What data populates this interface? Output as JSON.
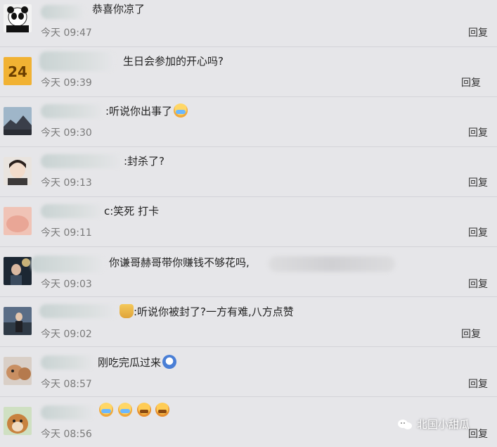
{
  "comments": [
    {
      "text": "恭喜你凉了",
      "time": "今天 09:47",
      "reply": "回复",
      "emoji": ""
    },
    {
      "text": "生日会参加的开心吗?",
      "time": "今天 09:39",
      "reply": "回复",
      "emoji": ""
    },
    {
      "text": ":听说你出事了",
      "time": "今天 09:30",
      "reply": "回复",
      "emoji": "crying-face"
    },
    {
      "text": ":封杀了?",
      "time": "今天 09:13",
      "reply": "回复",
      "emoji": ""
    },
    {
      "text": "c:笑死 打卡",
      "time": "今天 09:11",
      "reply": "回复",
      "emoji": ""
    },
    {
      "text": "你谦哥赫哥带你赚钱不够花吗,",
      "time": "今天 09:03",
      "reply": "回复",
      "emoji": ""
    },
    {
      "text": ":听说你被封了?一方有难,八方点赞",
      "time": "今天 09:02",
      "reply": "回复",
      "emoji": "cup"
    },
    {
      "text": "刚吃完瓜过来",
      "time": "今天 08:57",
      "reply": "回复",
      "emoji": "dizzy-face"
    },
    {
      "text": "",
      "time": "今天 08:56",
      "reply": "回复",
      "emoji": "crying-angry-group"
    }
  ],
  "row4": {
    "badge": "24"
  },
  "watermark": {
    "text": "北国小甜瓜"
  }
}
